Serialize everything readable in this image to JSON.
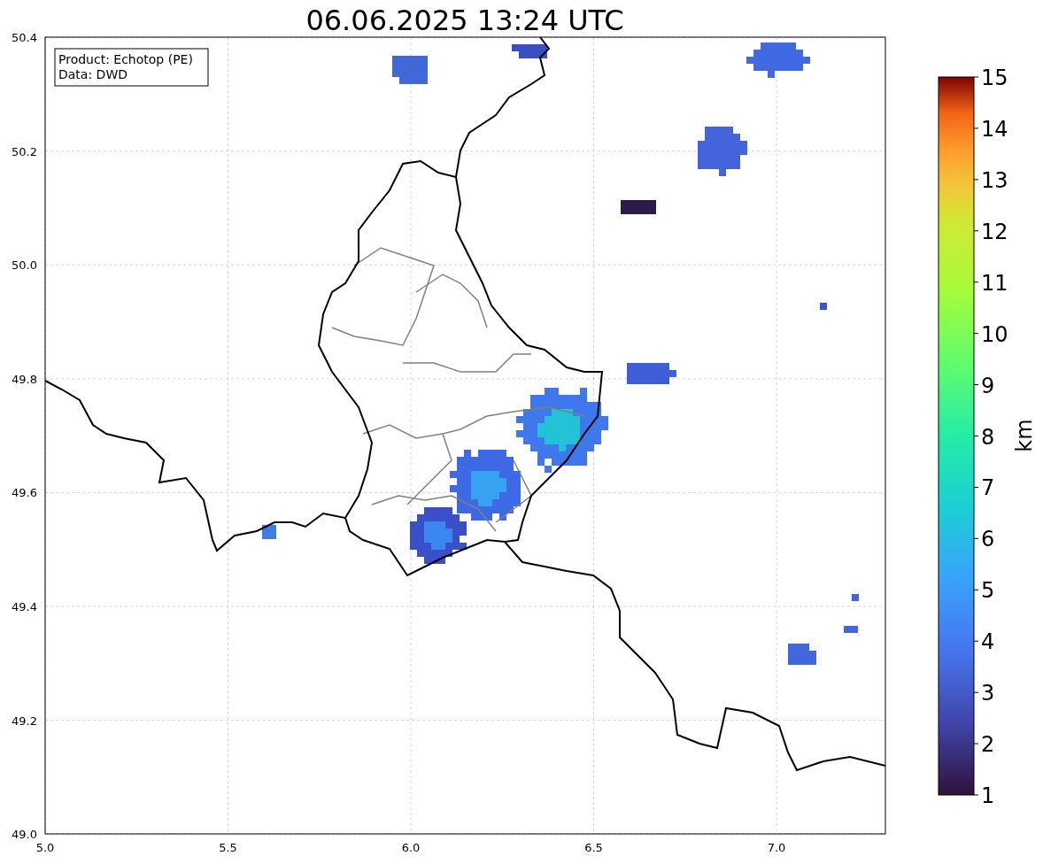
{
  "title": "06.06.2025 13:24 UTC",
  "info_box": [
    "Product: Echotop (PE)",
    "Data: DWD"
  ],
  "x_axis": {
    "ticks": [
      "5.0",
      "5.5",
      "6.0",
      "6.5",
      "7.0"
    ]
  },
  "y_axis": {
    "ticks": [
      "50.4",
      "50.2",
      "50.0",
      "49.8",
      "49.6",
      "49.4",
      "49.2",
      "49.0"
    ]
  },
  "colorbar": {
    "label": "km",
    "ticks": [
      "15",
      "14",
      "13",
      "12",
      "11",
      "10",
      "9",
      "8",
      "7",
      "6",
      "5",
      "4",
      "3",
      "2",
      "1"
    ]
  }
}
